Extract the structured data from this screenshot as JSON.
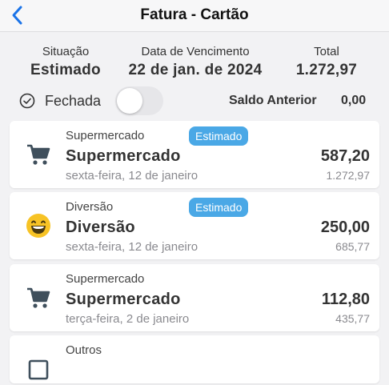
{
  "nav": {
    "title": "Fatura - Cartão"
  },
  "summary": {
    "status_label": "Situação",
    "status_value": "Estimado",
    "due_label": "Data de Vencimento",
    "due_value": "22 de jan. de 2024",
    "total_label": "Total",
    "total_value": "1.272,97"
  },
  "status_row": {
    "closed_label": "Fechada",
    "closed_on": false,
    "prev_balance_label": "Saldo Anterior",
    "prev_balance_value": "0,00"
  },
  "transactions": [
    {
      "category": "Supermercado",
      "badge": "Estimado",
      "title": "Supermercado",
      "amount": "587,20",
      "date": "sexta-feira, 12 de janeiro",
      "balance": "1.272,97",
      "icon": "shopping-cart-icon"
    },
    {
      "category": "Diversão",
      "badge": "Estimado",
      "title": "Diversão",
      "amount": "250,00",
      "date": "sexta-feira, 12 de janeiro",
      "balance": "685,77",
      "icon": "smiley-face-icon"
    },
    {
      "category": "Supermercado",
      "badge": "",
      "title": "Supermercado",
      "amount": "112,80",
      "date": "terça-feira, 2 de janeiro",
      "balance": "435,77",
      "icon": "shopping-cart-icon"
    },
    {
      "category": "Outros",
      "badge": "",
      "title": "",
      "amount": "",
      "date": "",
      "balance": "",
      "icon": "square-icon"
    }
  ],
  "colors": {
    "accent": "#1a73e8",
    "badge": "#4aa8e6",
    "emoji": "#f7c325"
  }
}
